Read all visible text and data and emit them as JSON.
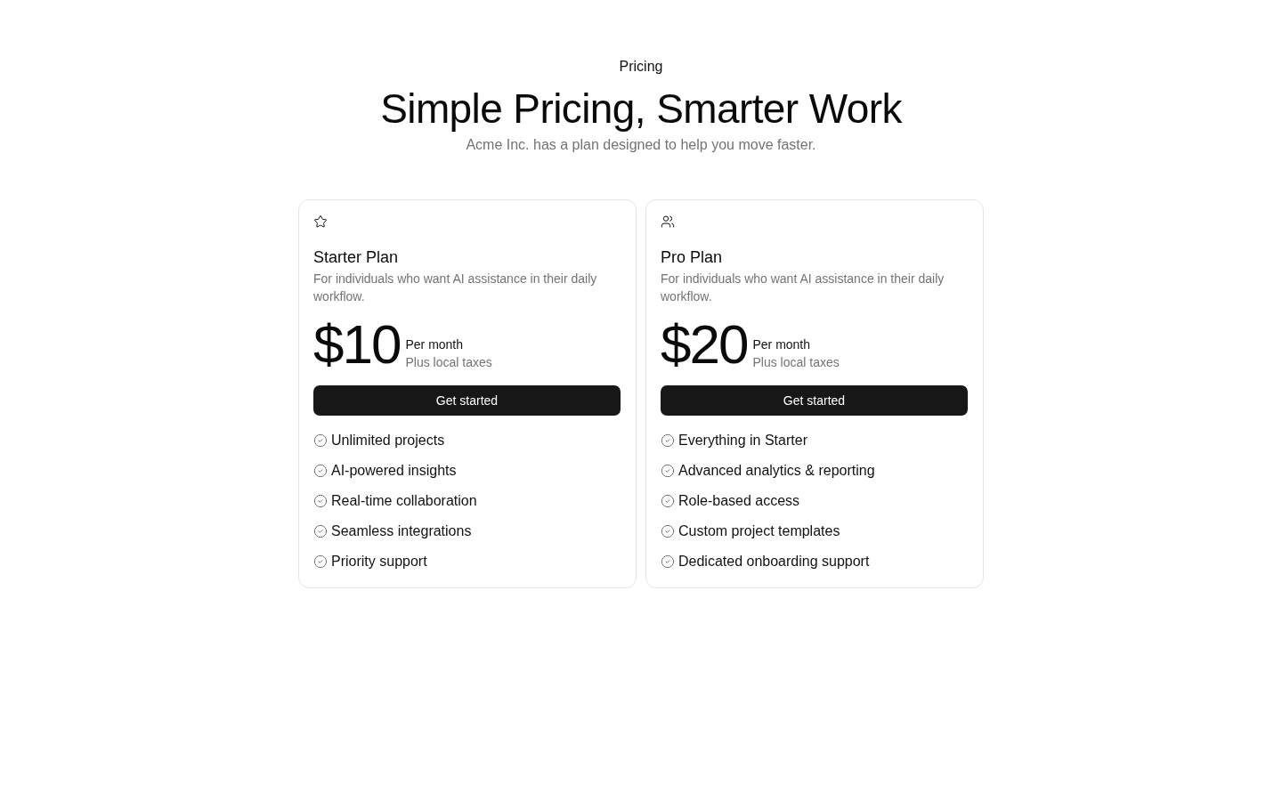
{
  "header": {
    "eyebrow": "Pricing",
    "title": "Simple Pricing, Smarter Work",
    "subtitle": "Acme Inc. has a plan designed to help you move faster."
  },
  "plans": [
    {
      "name": "Starter Plan",
      "description": "For individuals who want AI assistance in their daily workflow.",
      "price": "$10",
      "period": "Per month",
      "tax_note": "Plus local taxes",
      "button": "Get started",
      "features": [
        "Unlimited projects",
        "AI-powered insights",
        "Real-time collaboration",
        "Seamless integrations",
        "Priority support"
      ]
    },
    {
      "name": "Pro Plan",
      "description": "For individuals who want AI assistance in their daily workflow.",
      "price": "$20",
      "period": "Per month",
      "tax_note": "Plus local taxes",
      "button": "Get started",
      "features": [
        "Everything in Starter",
        "Advanced analytics & reporting",
        "Role-based access",
        "Custom project templates",
        "Dedicated onboarding support"
      ]
    }
  ]
}
